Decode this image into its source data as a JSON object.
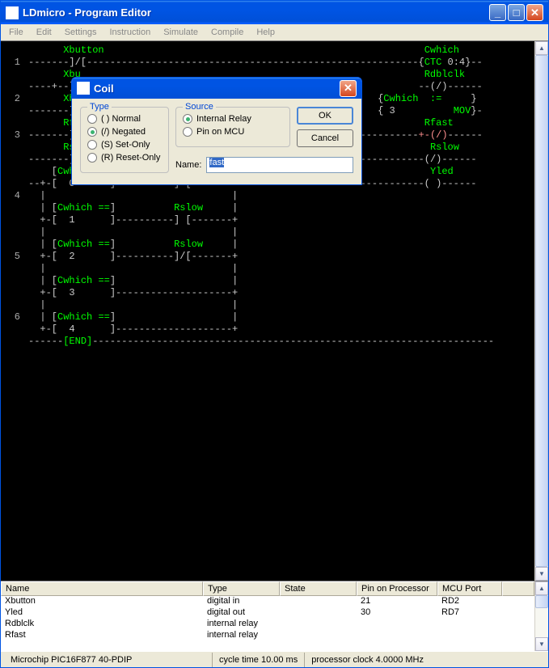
{
  "window": {
    "title": "LDmicro - Program Editor",
    "menus": [
      "File",
      "Edit",
      "Settings",
      "Instruction",
      "Simulate",
      "Compile",
      "Help"
    ]
  },
  "dialog": {
    "title": "Coil",
    "groups": {
      "type": {
        "legend": "Type",
        "options": [
          "( ) Normal",
          "(/) Negated",
          "(S) Set-Only",
          "(R) Reset-Only"
        ],
        "selected": 1
      },
      "source": {
        "legend": "Source",
        "options": [
          "Internal Relay",
          "Pin on MCU"
        ],
        "selected": 0
      }
    },
    "name_label": "Name:",
    "name_value": "fast",
    "buttons": {
      "ok": "OK",
      "cancel": "Cancel"
    }
  },
  "ladder": {
    "rungs": [
      {
        "num": 1,
        "lines": [
          "      Xbutton                                                       Cwhich    ",
          "-------]/[---------------------------------------------------------{CTC 0:4}--",
          ""
        ]
      },
      {
        "num": 2,
        "lines": [
          "      Xbu                                                           Rdblclk   ",
          "----+--] [                                                         --(/)------",
          ""
        ]
      },
      {
        "num": 3,
        "lines": [
          "      Xbu                                                   {Cwhich  :=     } ",
          "-------] [                                                  { 3          MOV}-",
          "",
          "",
          ""
        ]
      },
      {
        "num": 4,
        "lines": [
          "      Rfast            Tffast            Tnfast                     Rfast     ",
          "-------] [---------[TOF 100.0 ms]----[TON 100.0 ms]----------------+-(/)------",
          "",
          "",
          ""
        ]
      },
      {
        "num": 5,
        "lines": [
          "      Rslow            Tnslow            Tfslow                      Rslow    ",
          "-------] [---------[TON 100.0 ms]----[TOF 1.000 s]------------------(/)------",
          "",
          "",
          ""
        ]
      },
      {
        "num": 6,
        "lines": [
          "    [Cwhich ==]          Rfast                                       Yled     ",
          "--+-[  0      ]----------] [-------+--------------------------------( )------",
          "  |                                |",
          "  | [Cwhich ==]          Rslow     |",
          "  +-[  1      ]----------] [-------+",
          "  |                                |",
          "  | [Cwhich ==]          Rslow     |",
          "  +-[  2      ]----------]/[-------+",
          "  |                                |",
          "  | [Cwhich ==]                    |",
          "  +-[  3      ]--------------------+",
          "  |                                |",
          "  | [Cwhich ==]                    |",
          "  +-[  4      ]--------------------+",
          "",
          ""
        ]
      }
    ],
    "end": "------[END]---------------------------------------------------------------------"
  },
  "io_table": {
    "headers": [
      "Name",
      "Type",
      "State",
      "Pin on Processor",
      "MCU Port"
    ],
    "rows": [
      {
        "name": "Xbutton",
        "type": "digital in",
        "state": "",
        "pin": "21",
        "port": "RD2"
      },
      {
        "name": "Yled",
        "type": "digital out",
        "state": "",
        "pin": "30",
        "port": "RD7"
      },
      {
        "name": "Rdblclk",
        "type": "internal relay",
        "state": "",
        "pin": "",
        "port": ""
      },
      {
        "name": "Rfast",
        "type": "internal relay",
        "state": "",
        "pin": "",
        "port": ""
      }
    ]
  },
  "statusbar": {
    "mcu": "Microchip PIC16F877 40-PDIP",
    "cycle": "cycle time 10.00 ms",
    "clock": "processor clock 4.0000 MHz"
  }
}
